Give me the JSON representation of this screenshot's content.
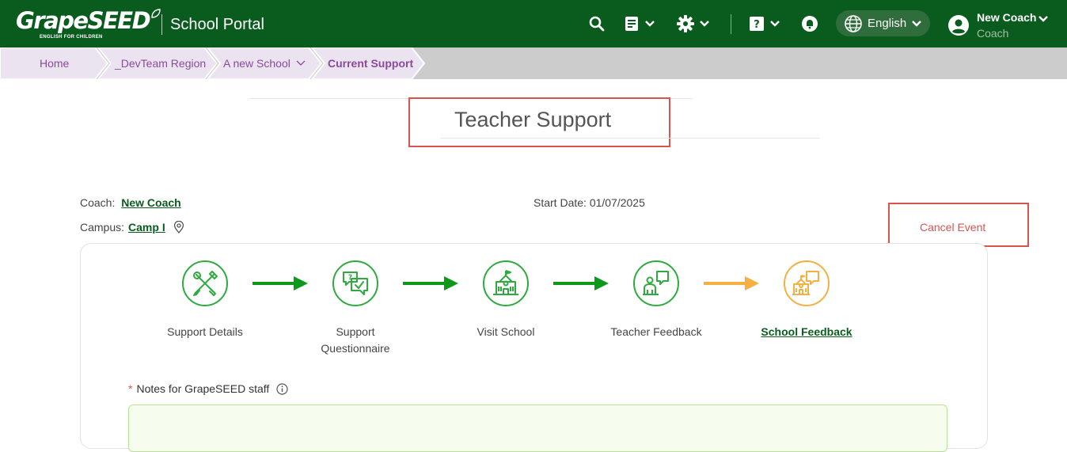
{
  "header": {
    "logo_text": "GrapeSEED",
    "logo_tagline": "ENGLISH FOR CHILDREN",
    "portal_title": "School Portal",
    "language": "English",
    "user_name": "New Coach",
    "user_role": "Coach",
    "icons": [
      "search-icon",
      "document-icon",
      "gear-icon",
      "help-icon",
      "bell-icon",
      "globe-icon",
      "avatar-icon"
    ]
  },
  "breadcrumb": [
    {
      "label": "Home"
    },
    {
      "label": "_DevTeam Region"
    },
    {
      "label": "A new School"
    },
    {
      "label": "Current Support"
    }
  ],
  "page": {
    "title": "Teacher Support",
    "coach_label": "Coach:",
    "coach_value": "New Coach",
    "start_date_label": "Start Date:",
    "start_date_value": "01/07/2025",
    "campus_label": "Campus:",
    "campus_value": "Camp I",
    "cancel_label": "Cancel Event"
  },
  "steps": [
    {
      "label": "Support Details",
      "status": "done",
      "icon": "tools-icon"
    },
    {
      "label": "Support Questionnaire",
      "status": "done",
      "icon": "questionnaire-icon"
    },
    {
      "label": "Visit School",
      "status": "done",
      "icon": "school-icon"
    },
    {
      "label": "Teacher Feedback",
      "status": "done",
      "icon": "teacher-feedback-icon"
    },
    {
      "label": "School Feedback",
      "status": "current",
      "icon": "school-feedback-icon"
    }
  ],
  "notes": {
    "required_mark": "*",
    "label": "Notes for GrapeSEED staff"
  },
  "colors": {
    "brand_green": "#0a5c1e",
    "step_green": "#2eaa3f",
    "arrow_green": "#0d9a1a",
    "pending_orange": "#f5b041",
    "breadcrumb_purple": "#8a4a9c",
    "cancel_red": "#d9534f"
  }
}
